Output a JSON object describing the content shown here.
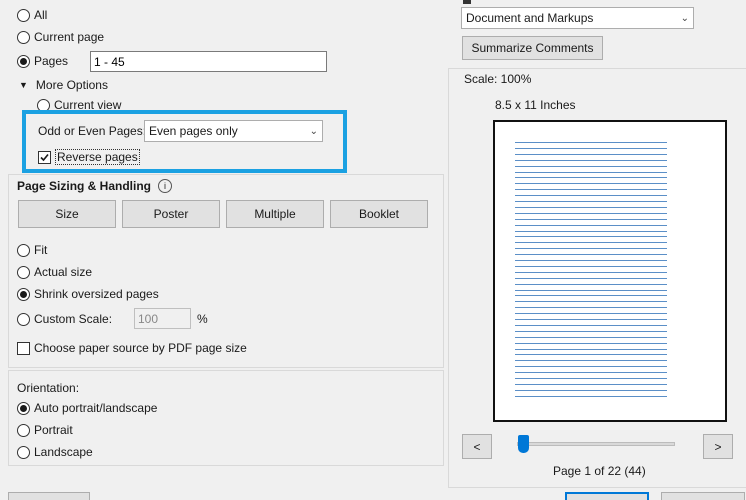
{
  "print_range": {
    "all_label": "All",
    "current_page_label": "Current page",
    "pages_label": "Pages",
    "pages_value": "1 - 45",
    "more_options_label": "More Options",
    "current_view_label": "Current view",
    "odd_even_label": "Odd or Even Pages:",
    "odd_even_value": "Even pages only",
    "reverse_pages_label": "Reverse pages"
  },
  "page_sizing": {
    "title": "Page Sizing & Handling",
    "tabs": [
      "Size",
      "Poster",
      "Multiple",
      "Booklet"
    ],
    "fit_label": "Fit",
    "actual_size_label": "Actual size",
    "shrink_label": "Shrink oversized pages",
    "custom_scale_label": "Custom Scale:",
    "custom_scale_value": "100",
    "percent_label": "%",
    "paper_source_label": "Choose paper source by PDF page size"
  },
  "orientation": {
    "title": "Orientation:",
    "auto_label": "Auto portrait/landscape",
    "portrait_label": "Portrait",
    "landscape_label": "Landscape"
  },
  "comments": {
    "select_value": "Document and Markups",
    "summarize_label": "Summarize Comments"
  },
  "preview": {
    "scale_label": "Scale: 100%",
    "size_label": "8.5 x 11 Inches",
    "prev_label": "<",
    "next_label": ">",
    "page_status": "Page 1 of 22 (44)",
    "slider_position": 0.0
  },
  "colors": {
    "highlight": "#1ba1e2",
    "slider_thumb": "#0078d7"
  }
}
